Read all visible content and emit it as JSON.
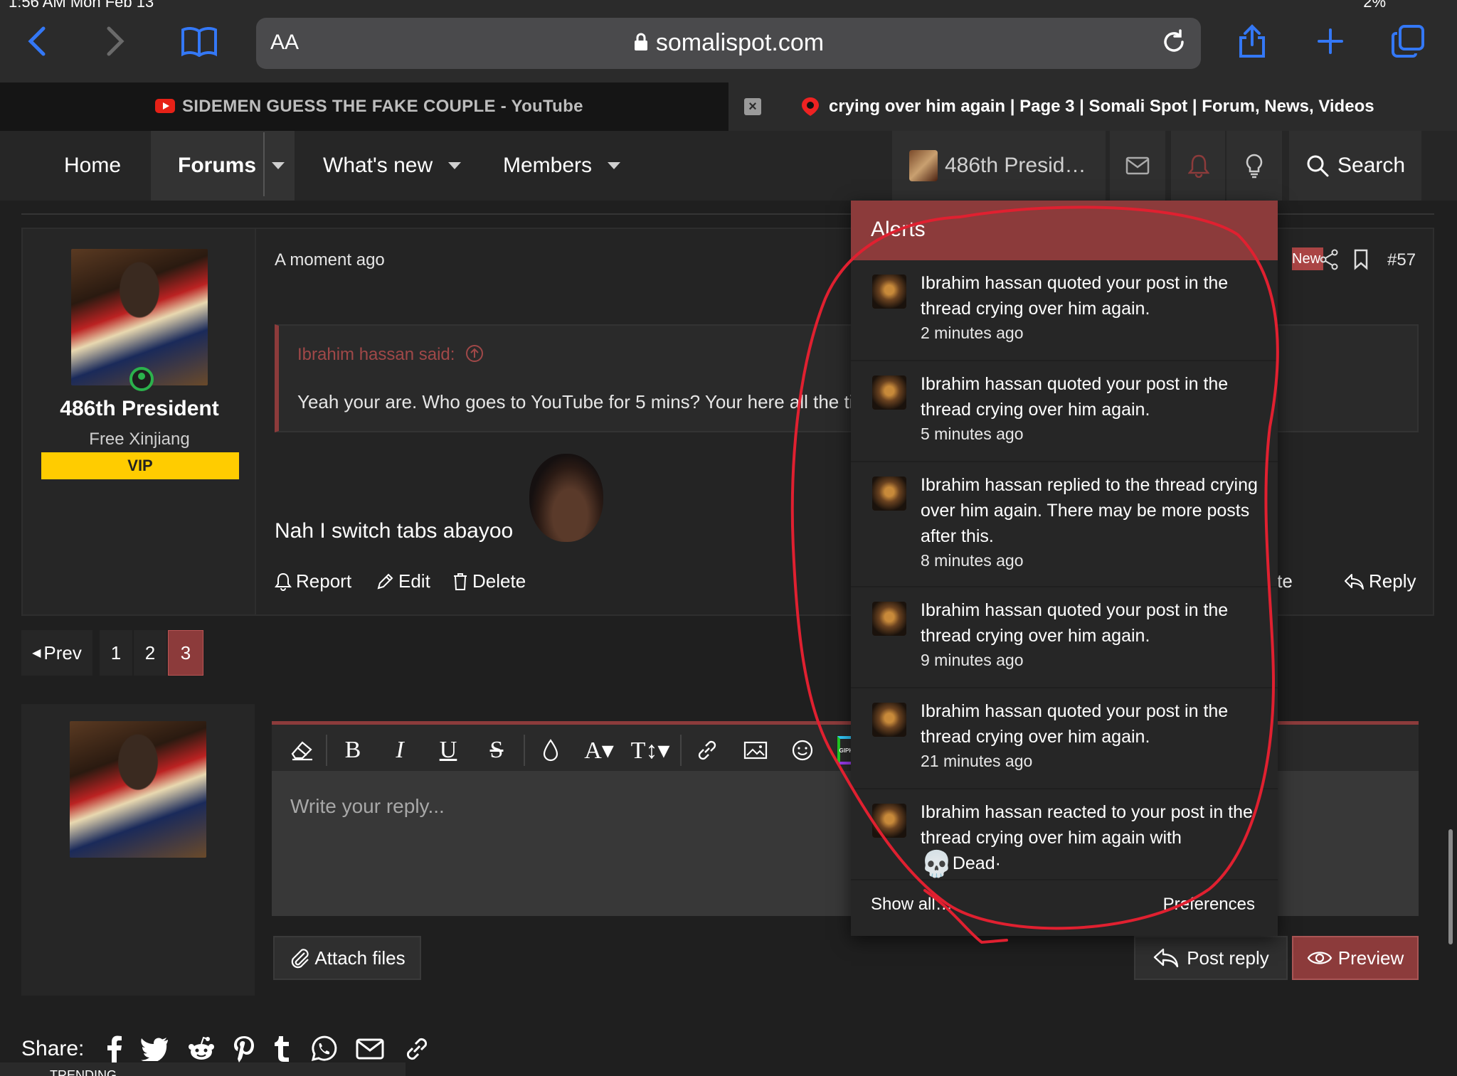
{
  "browser": {
    "status_time": "1:56 AM  Mon Feb 13",
    "status_battery": "2%",
    "text_size_button": "AA",
    "url": "somalispot.com",
    "tabs": [
      {
        "title": "SIDEMEN GUESS THE FAKE COUPLE - YouTube"
      },
      {
        "title": "crying over him again | Page 3 | Somali Spot | Forum, News, Videos"
      }
    ]
  },
  "nav": {
    "home": "Home",
    "forums": "Forums",
    "whats_new": "What's new",
    "members": "Members",
    "user": "486th Presid…",
    "search": "Search"
  },
  "post": {
    "time": "A moment ago",
    "number": "#57",
    "new_badge": "New",
    "author": {
      "name": "486th President",
      "title": "Free Xinjiang",
      "badge": "VIP"
    },
    "quote": {
      "author": "Ibrahim hassan said:",
      "text": "Yeah your are. Who goes to YouTube for 5 mins? Your here all the ti"
    },
    "body": "Nah I switch tabs abayoo",
    "actions": {
      "report": "Report",
      "edit": "Edit",
      "delete": "Delete",
      "quote": "Quote",
      "reply": "Reply"
    }
  },
  "pagination": {
    "prev": "Prev",
    "pages": [
      "1",
      "2",
      "3"
    ],
    "current": "3"
  },
  "editor": {
    "placeholder": "Write your reply...",
    "attach": "Attach files",
    "post_reply": "Post reply",
    "preview": "Preview",
    "giphy": "GIPHY"
  },
  "share": {
    "label": "Share:",
    "trending": "TRENDING"
  },
  "alerts": {
    "title": "Alerts",
    "items": [
      {
        "text": "Ibrahim hassan quoted your post in the thread crying over him again.",
        "time": "2 minutes ago"
      },
      {
        "text": "Ibrahim hassan quoted your post in the thread crying over him again.",
        "time": "5 minutes ago"
      },
      {
        "text": "Ibrahim hassan replied to the thread crying over him again. There may be more posts after this.",
        "time": "8 minutes ago"
      },
      {
        "text": "Ibrahim hassan quoted your post in the thread crying over him again.",
        "time": "9 minutes ago"
      },
      {
        "text": "Ibrahim hassan quoted your post in the thread crying over him again.",
        "time": "21 minutes ago"
      },
      {
        "text": "Ibrahim hassan reacted to your post in the thread crying over him again with",
        "reaction": "Dead",
        "reaction_icon": "💀",
        "reaction_suffix": "·"
      }
    ],
    "show_all": "Show all…",
    "preferences": "Preferences"
  },
  "colors": {
    "accent": "#8c3b3b",
    "safari_blue": "#3478f6",
    "vip": "#ffcc00",
    "annotation": "#e02030"
  }
}
